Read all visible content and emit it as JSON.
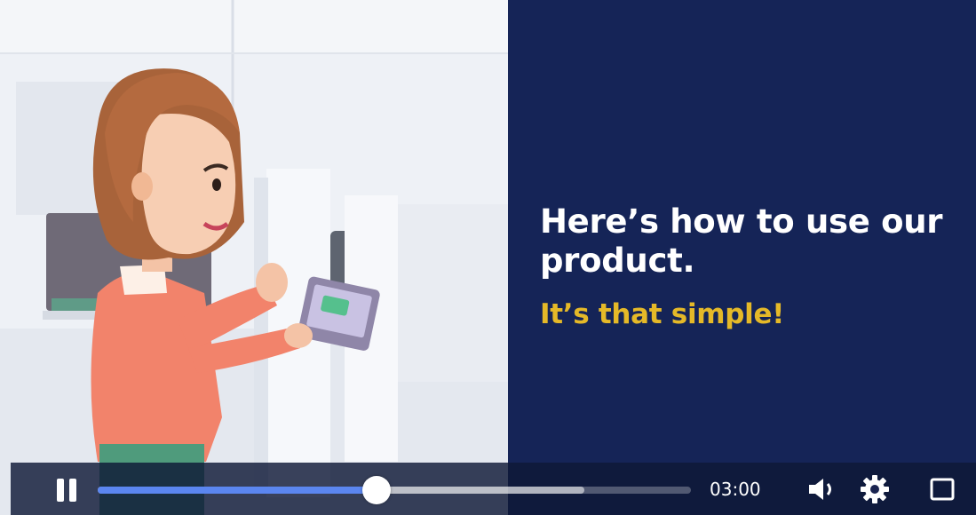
{
  "slide": {
    "headline": "Here’s how to use our product.",
    "subline": "It’s that simple!"
  },
  "player": {
    "time_display": "03:00",
    "progress_fraction": 0.47,
    "buffered_fraction": 0.82,
    "state": "playing",
    "icons": {
      "play_pause": "pause-icon",
      "volume": "volume-icon",
      "settings": "gear-icon",
      "fullscreen": "fullscreen-icon"
    }
  },
  "colors": {
    "panel_navy": "#152457",
    "headline_white": "#ffffff",
    "subline_yellow": "#e5b928",
    "progress_blue": "#5b86f0"
  }
}
